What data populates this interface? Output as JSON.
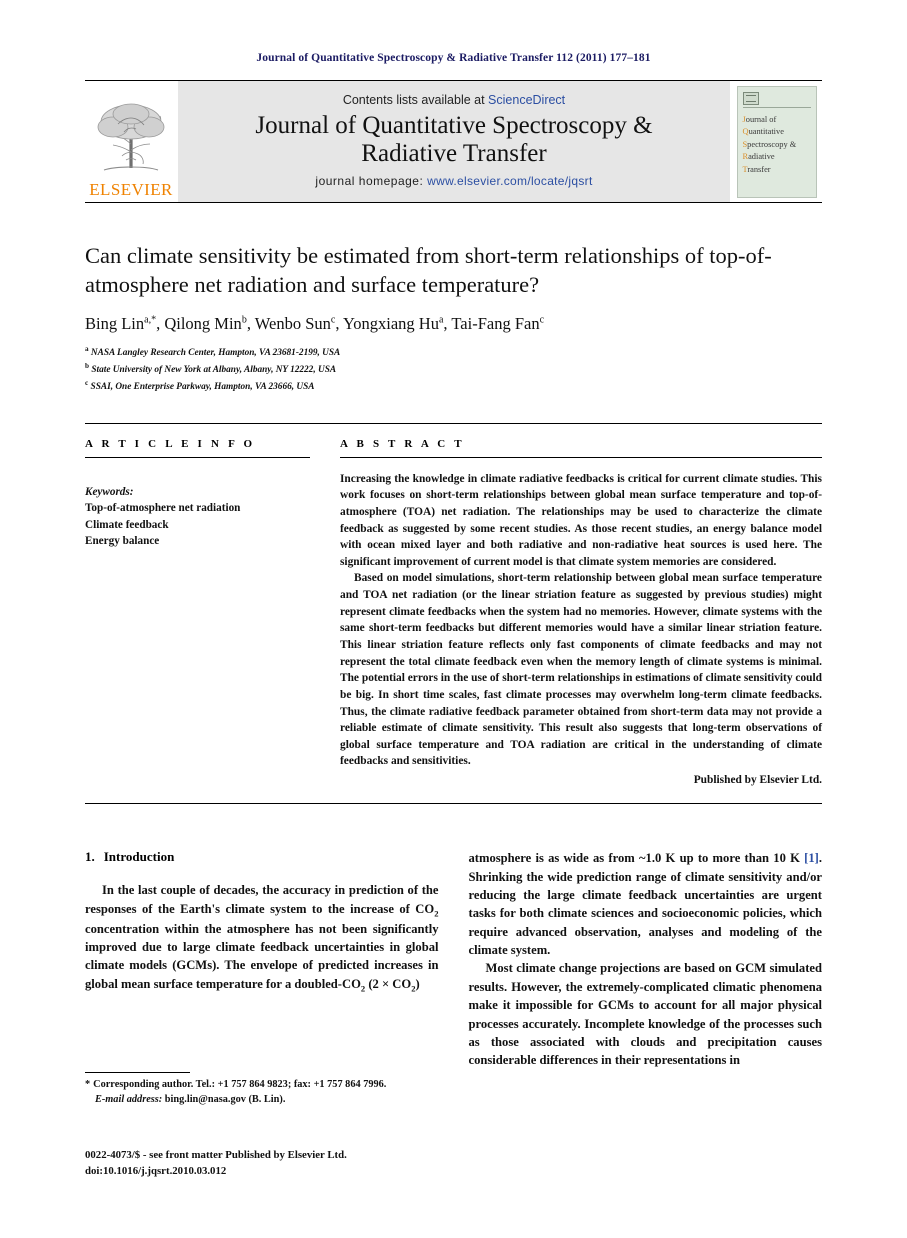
{
  "running_head": "Journal of Quantitative Spectroscopy & Radiative Transfer 112 (2011) 177–181",
  "masthead": {
    "contents_prefix": "Contents lists available at ",
    "sciencedirect": "ScienceDirect",
    "journal_title_line1": "Journal of Quantitative Spectroscopy &",
    "journal_title_line2": "Radiative Transfer",
    "homepage_label": "journal homepage: ",
    "homepage_url": "www.elsevier.com/locate/jqsrt",
    "publisher_wordmark": "ELSEVIER",
    "cover_title_parts": [
      {
        "cap": "J",
        "rest": "ournal of"
      },
      {
        "cap": "Q",
        "rest": "uantitative"
      },
      {
        "cap": "S",
        "rest": "pectroscopy &"
      },
      {
        "cap": "R",
        "rest": "adiative"
      },
      {
        "cap": "T",
        "rest": "ransfer"
      }
    ]
  },
  "article": {
    "title": "Can climate sensitivity be estimated from short-term relationships of top-of-atmosphere net radiation and surface temperature?",
    "authors": [
      {
        "name": "Bing Lin",
        "marks": "a,*"
      },
      {
        "name": "Qilong Min",
        "marks": "b"
      },
      {
        "name": "Wenbo Sun",
        "marks": "c"
      },
      {
        "name": "Yongxiang Hu",
        "marks": "a"
      },
      {
        "name": "Tai-Fang Fan",
        "marks": "c"
      }
    ],
    "affiliations": [
      {
        "mark": "a",
        "text": "NASA Langley Research Center, Hampton, VA 23681-2199, USA"
      },
      {
        "mark": "b",
        "text": "State University of New York at Albany, Albany, NY 12222, USA"
      },
      {
        "mark": "c",
        "text": "SSAI, One Enterprise Parkway, Hampton, VA 23666, USA"
      }
    ]
  },
  "info": {
    "heading": "A R T I C L E  I N F O",
    "keywords_label": "Keywords:",
    "keywords": [
      "Top-of-atmosphere net radiation",
      "Climate feedback",
      "Energy balance"
    ]
  },
  "abstract": {
    "heading": "A B S T R A C T",
    "paragraphs": [
      "Increasing the knowledge in climate radiative feedbacks is critical for current climate studies. This work focuses on short-term relationships between global mean surface temperature and top-of-atmosphere (TOA) net radiation. The relationships may be used to characterize the climate feedback as suggested by some recent studies. As those recent studies, an energy balance model with ocean mixed layer and both radiative and non-radiative heat sources is used here. The significant improvement of current model is that climate system memories are considered.",
      "Based on model simulations, short-term relationship between global mean surface temperature and TOA net radiation (or the linear striation feature as suggested by previous studies) might represent climate feedbacks when the system had no memories. However, climate systems with the same short-term feedbacks but different memories would have a similar linear striation feature. This linear striation feature reflects only fast components of climate feedbacks and may not represent the total climate feedback even when the memory length of climate systems is minimal. The potential errors in the use of short-term relationships in estimations of climate sensitivity could be big. In short time scales, fast climate processes may overwhelm long-term climate feedbacks. Thus, the climate radiative feedback parameter obtained from short-term data may not provide a reliable estimate of climate sensitivity. This result also suggests that long-term observations of global surface temperature and TOA radiation are critical in the understanding of climate feedbacks and sensitivities."
    ],
    "published_by": "Published by Elsevier Ltd."
  },
  "introduction": {
    "number": "1.",
    "title": "Introduction",
    "left_paragraph_part1": "In the last couple of decades, the accuracy in prediction of the responses of the Earth's climate system to the increase of CO",
    "left_paragraph_part2": " concentration within the atmosphere has not been significantly improved due to large climate feedback uncertainties in global climate models (GCMs). The envelope of predicted increases in global mean surface temperature for a doubled-CO",
    "left_paragraph_part3": " (2 × CO",
    "left_paragraph_part4": ")",
    "right_paragraph_1_pre": "atmosphere is as wide as from ~1.0 K up to more than 10 K ",
    "right_citation": "[1]",
    "right_paragraph_1_post": ". Shrinking the wide prediction range of climate sensitivity and/or reducing the large climate feedback uncertainties are urgent tasks for both climate sciences and socioeconomic policies, which require advanced observation, analyses and modeling of the climate system.",
    "right_paragraph_2": "Most climate change projections are based on GCM simulated results. However, the extremely-complicated climatic phenomena make it impossible for GCMs to account for all major physical processes accurately. Incomplete knowledge of the processes such as those associated with clouds and precipitation causes considerable differences in their representations in"
  },
  "footnotes": {
    "corresponding_marker": "*",
    "corresponding_text": "Corresponding author. Tel.: +1 757 864 9823; fax: +1 757 864 7996.",
    "email_label": "E-mail address:",
    "email_value": "bing.lin@nasa.gov (B. Lin)."
  },
  "footer": {
    "issn_line": "0022-4073/$ - see front matter Published by Elsevier Ltd.",
    "doi_line": "doi:10.1016/j.jqsrt.2010.03.012"
  },
  "colors": {
    "running_head": "#1b1b63",
    "link_blue": "#2b4ea2",
    "elsevier_orange": "#ef8200",
    "cover_green": "#dfe9de"
  }
}
